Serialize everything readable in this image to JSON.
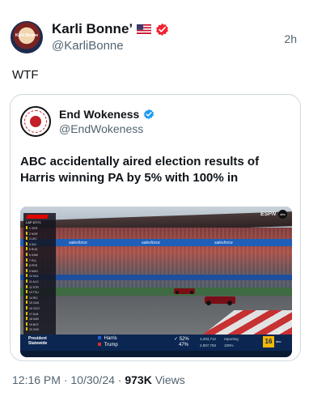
{
  "outer_post": {
    "display_name": "Karli Bonne’",
    "handle": "@KarliBonne",
    "time": "2h",
    "text": "WTF",
    "avatar_caption": "Karli Bonne"
  },
  "quoted_post": {
    "display_name": "End Wokeness",
    "handle": "@EndWokeness",
    "text": "ABC accidentally aired election results of Harris winning PA by 5% with 100% in"
  },
  "tv_screenshot": {
    "network_bug": "ESPN",
    "network_abc": "abc",
    "sponsor": "salesforce",
    "lap_label": "LAP 67/71",
    "ticker": {
      "office_line1": "President",
      "office_line2": "Statewide",
      "candidates": [
        {
          "name": "Harris",
          "check": "✓",
          "pct": "52%",
          "votes": "3,293,712",
          "reporting_label": "reporting",
          "color": "#1f5fd6"
        },
        {
          "name": "Trump",
          "check": "",
          "pct": "47%",
          "votes": "2,997,793",
          "reporting_label": "100%",
          "color": "#d0312d"
        }
      ],
      "channel": "16",
      "channel_label": "abc"
    },
    "leaderboard_codes": [
      "VER",
      "NOR",
      "LEC",
      "SAI",
      "RUS",
      "HAM",
      "PIA",
      "PER",
      "MAG",
      "HUL",
      "ALO",
      "STR",
      "TSU",
      "RIC",
      "GAS",
      "OCO",
      "ALB",
      "SAR",
      "BOT",
      "ZHO"
    ]
  },
  "footer": {
    "time": "12:16 PM",
    "date": "10/30/24",
    "views_count": "973K",
    "views_label": "Views",
    "separator": "·"
  }
}
